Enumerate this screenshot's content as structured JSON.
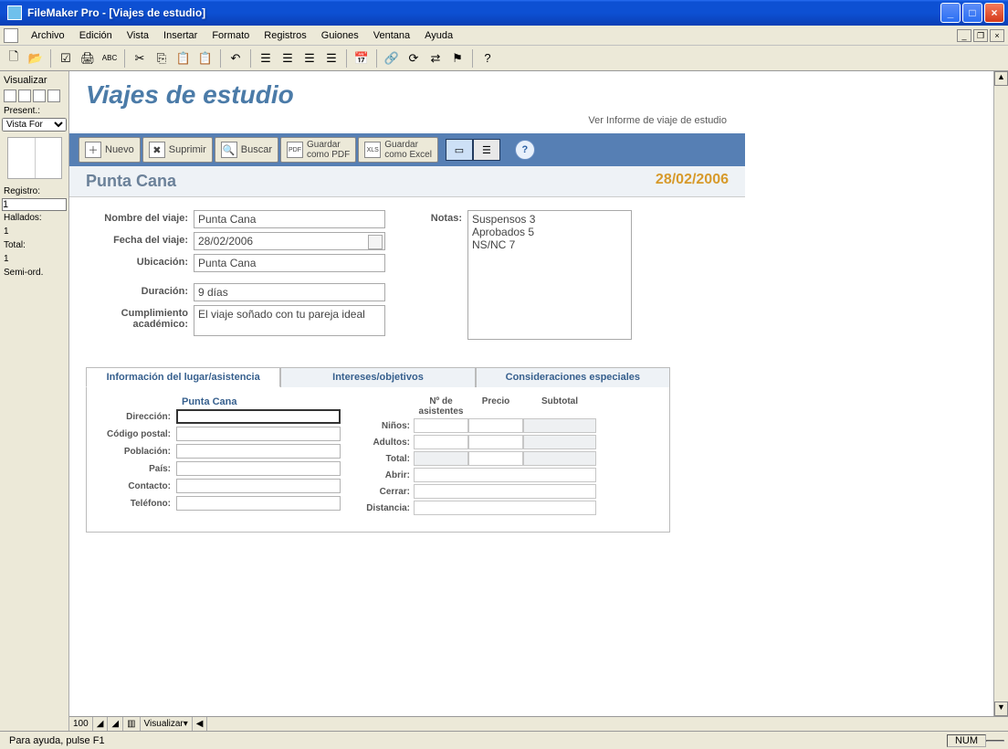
{
  "window": {
    "title": "FileMaker Pro - [Viajes de estudio]"
  },
  "menu": {
    "items": [
      "Archivo",
      "Edición",
      "Vista",
      "Insertar",
      "Formato",
      "Registros",
      "Guiones",
      "Ventana",
      "Ayuda"
    ]
  },
  "toolbar": {
    "icons": [
      "new-doc",
      "open",
      "",
      "checkbox",
      "print",
      "spell",
      "",
      "cut",
      "copy",
      "paste",
      "paste-special",
      "",
      "undo",
      "",
      "grid1",
      "grid2",
      "grid3",
      "grid4",
      "",
      "calendar",
      "",
      "link",
      "refresh",
      "sync",
      "flag",
      "",
      "help"
    ]
  },
  "sidebar": {
    "title": "Visualizar",
    "present_label": "Present.:",
    "present_value": "Vista For",
    "registro_label": "Registro:",
    "registro_value": "1",
    "hallados_label": "Hallados:",
    "hallados_value": "1",
    "total_label": "Total:",
    "total_value": "1",
    "sort_label": "Semi-ord."
  },
  "page": {
    "title": "Viajes de estudio",
    "report_link": "Ver Informe de viaje de estudio"
  },
  "actionbar": {
    "nuevo": "Nuevo",
    "suprimir": "Suprimir",
    "buscar": "Buscar",
    "guardar_pdf_l1": "Guardar",
    "guardar_pdf_l2": "como PDF",
    "guardar_xls_l1": "Guardar",
    "guardar_xls_l2": "como Excel"
  },
  "record": {
    "name": "Punta Cana",
    "date": "28/02/2006",
    "labels": {
      "nombre": "Nombre del viaje:",
      "fecha": "Fecha del viaje:",
      "ubicacion": "Ubicación:",
      "duracion": "Duración:",
      "cumpl1": "Cumplimiento",
      "cumpl2": "académico:",
      "notas": "Notas:"
    },
    "values": {
      "nombre": "Punta Cana",
      "fecha": "28/02/2006",
      "ubicacion": "Punta Cana",
      "duracion": "9 días",
      "cumplimiento": "El viaje soñado con tu pareja ideal",
      "notas": "Suspensos 3\nAprobados 5\nNS/NC 7"
    }
  },
  "tabs": {
    "t1": "Información del lugar/asistencia",
    "t2": "Intereses/objetivos",
    "t3": "Consideraciones especiales"
  },
  "addr": {
    "title": "Punta Cana",
    "direccion": "Dirección:",
    "cp": "Código postal:",
    "poblacion": "Población:",
    "pais": "País:",
    "contacto": "Contacto:",
    "telefono": "Teléfono:"
  },
  "grid": {
    "h1": "Nº de asistentes",
    "h2": "Precio",
    "h3": "Subtotal",
    "ninos": "Niños:",
    "adultos": "Adultos:",
    "total": "Total:",
    "abrir": "Abrir:",
    "cerrar": "Cerrar:",
    "distancia": "Distancia:"
  },
  "bottombar": {
    "zoom": "100",
    "mode": "Visualizar"
  },
  "status": {
    "help": "Para ayuda, pulse F1",
    "num": "NUM"
  }
}
